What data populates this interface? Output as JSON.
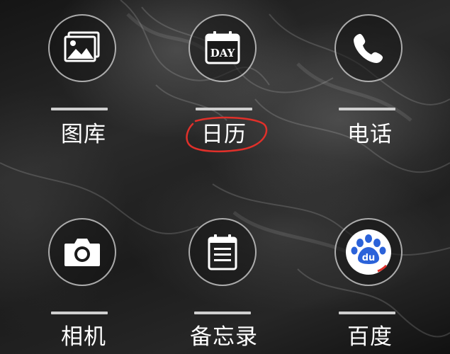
{
  "apps": [
    {
      "id": "gallery",
      "label": "图库",
      "icon": "gallery-icon"
    },
    {
      "id": "calendar",
      "label": "日历",
      "icon": "calendar-icon",
      "icon_text": "DAY"
    },
    {
      "id": "phone",
      "label": "电话",
      "icon": "phone-icon"
    },
    {
      "id": "camera",
      "label": "相机",
      "icon": "camera-icon"
    },
    {
      "id": "memo",
      "label": "备忘录",
      "icon": "notepad-icon"
    },
    {
      "id": "baidu",
      "label": "百度",
      "icon": "baidu-paw-icon",
      "icon_text": "du"
    }
  ],
  "colors": {
    "highlight_circle": "#e0302a",
    "baidu_blue": "#2b62d9",
    "icon_white": "#ffffff"
  }
}
